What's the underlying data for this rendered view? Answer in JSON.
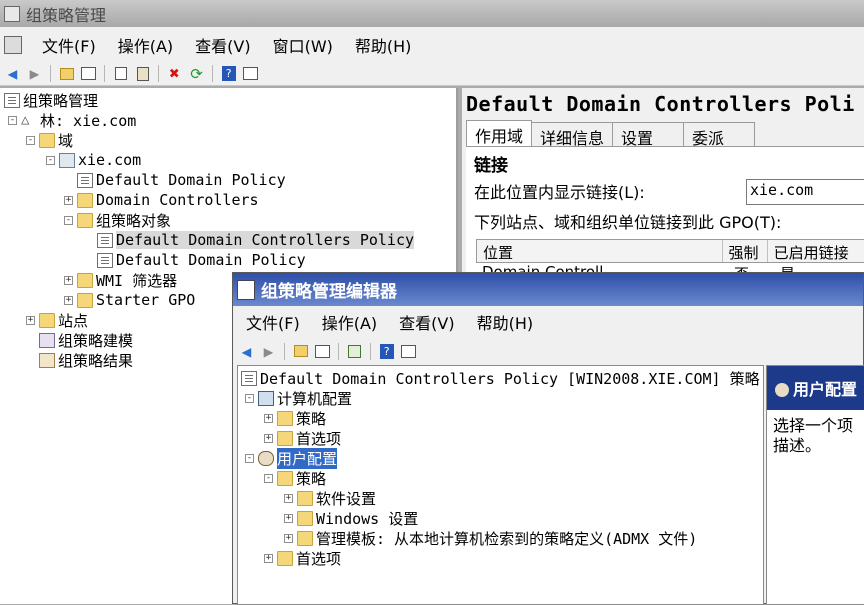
{
  "main": {
    "title": "组策略管理",
    "menu": [
      "文件(F)",
      "操作(A)",
      "查看(V)",
      "窗口(W)",
      "帮助(H)"
    ],
    "tree": {
      "root": "组策略管理",
      "forest": "林: xie.com",
      "domains": "域",
      "domain": "xie.com",
      "default_domain_policy": "Default Domain Policy",
      "domain_controllers": "Domain Controllers",
      "gpo_objects": "组策略对象",
      "gpo_ddcp": "Default Domain Controllers Policy",
      "gpo_ddp": "Default Domain Policy",
      "wmi_filters": "WMI 筛选器",
      "starter_gpo": "Starter GPO",
      "sites": "站点",
      "modeling": "组策略建模",
      "results": "组策略结果"
    },
    "details": {
      "heading": "Default Domain Controllers Poli",
      "tabs": [
        "作用域",
        "详细信息",
        "设置",
        "委派"
      ],
      "links_title": "链接",
      "display_links_label": "在此位置内显示链接(L):",
      "display_links_value": "xie.com",
      "linked_text": "下列站点、域和组织单位链接到此 GPO(T):",
      "columns": [
        "位置",
        "强制",
        "已启用链接"
      ],
      "row_partial": [
        "Domain Controll",
        "否",
        "是"
      ]
    }
  },
  "editor": {
    "title": "组策略管理编辑器",
    "menu": [
      "文件(F)",
      "操作(A)",
      "查看(V)",
      "帮助(H)"
    ],
    "tree": {
      "root": "Default Domain Controllers Policy [WIN2008.XIE.COM] 策略",
      "computer_config": "计算机配置",
      "cc_policies": "策略",
      "cc_preferences": "首选项",
      "user_config": "用户配置",
      "uc_policies": "策略",
      "software_settings": "软件设置",
      "windows_settings": "Windows 设置",
      "admin_templates": "管理模板: 从本地计算机检索到的策略定义(ADMX 文件)",
      "uc_preferences": "首选项"
    },
    "right": {
      "header": "用户配置",
      "desc_line1": "选择一个项",
      "desc_line2": "描述。"
    }
  }
}
